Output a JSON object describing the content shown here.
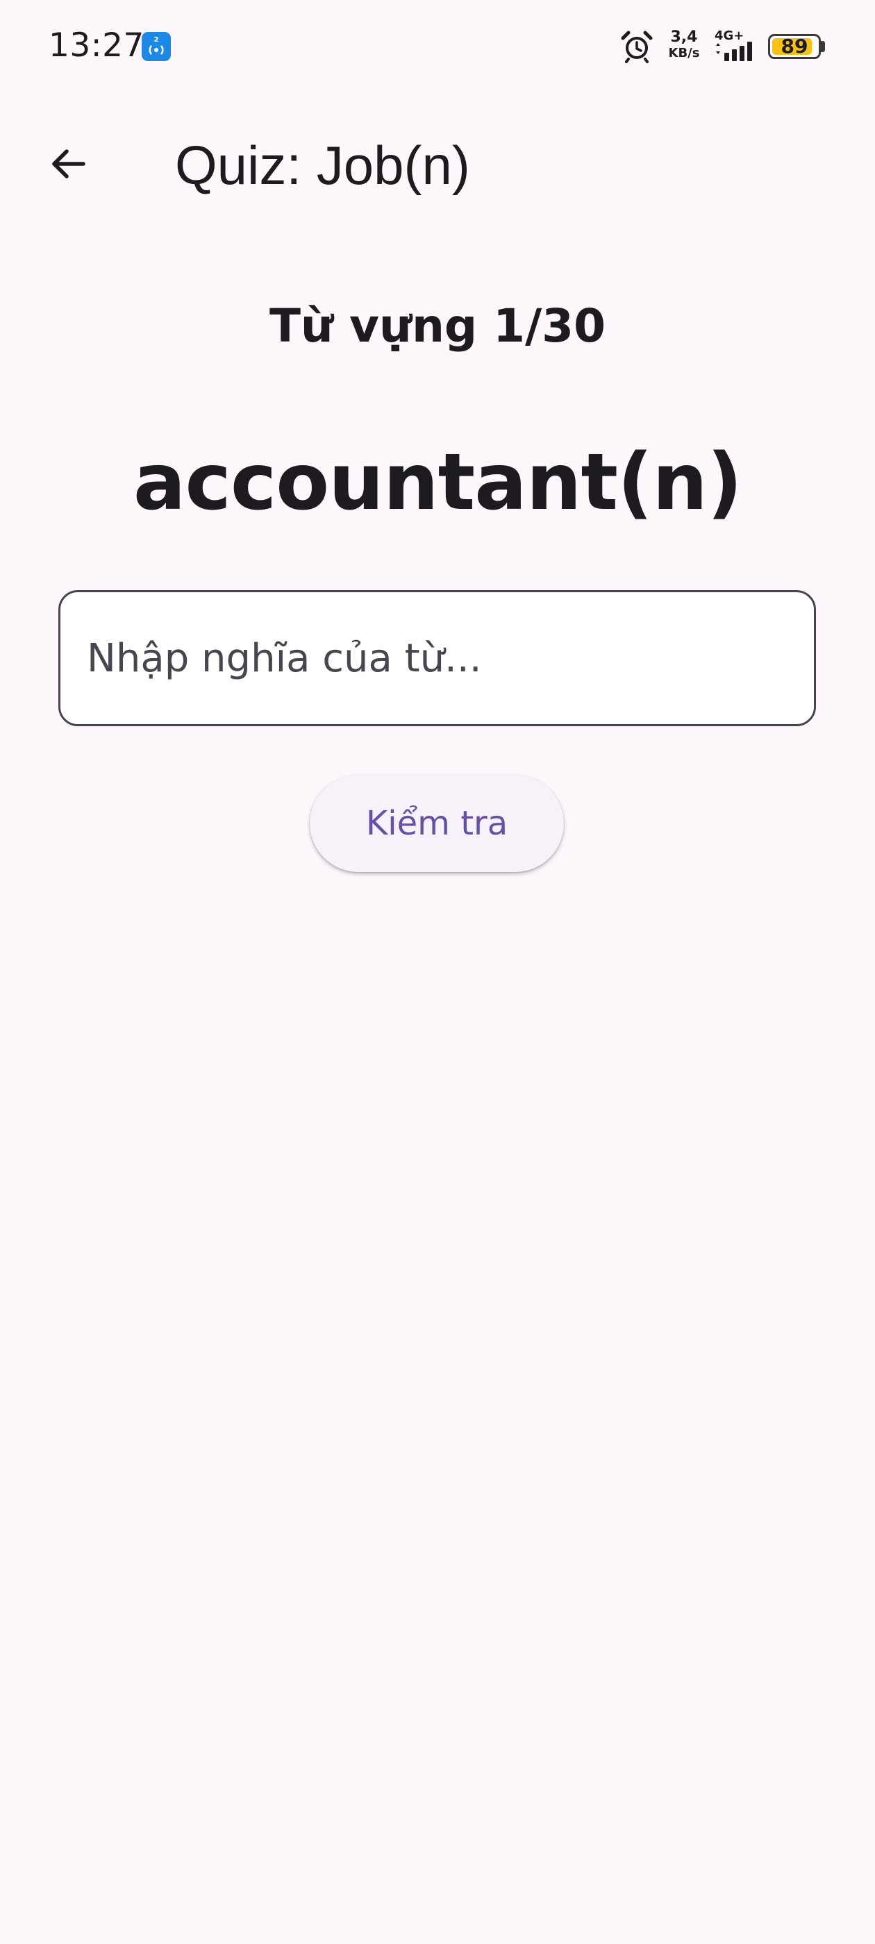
{
  "status_bar": {
    "time": "13:27",
    "net_speed_value": "3,4",
    "net_speed_unit": "KB/s",
    "network_type": "4G+",
    "battery_level": "89",
    "battery_fraction": 0.89,
    "icons": [
      "hotspot-icon",
      "alarm-icon",
      "signal-icon",
      "battery-icon"
    ]
  },
  "app_bar": {
    "back_icon": "arrow-back-icon",
    "title": "Quiz: Job(n)"
  },
  "quiz": {
    "progress_label": "Từ vựng 1/30",
    "word": "accountant(n)",
    "answer_value": "",
    "answer_placeholder": "Nhập nghĩa của từ...",
    "check_button_label": "Kiểm tra"
  },
  "colors": {
    "background": "#fdf7fc",
    "primary": "#6750a4",
    "text": "#1d1b20",
    "outline": "#49454f",
    "battery": "#f7c11a",
    "hotspot": "#1e88e5"
  }
}
